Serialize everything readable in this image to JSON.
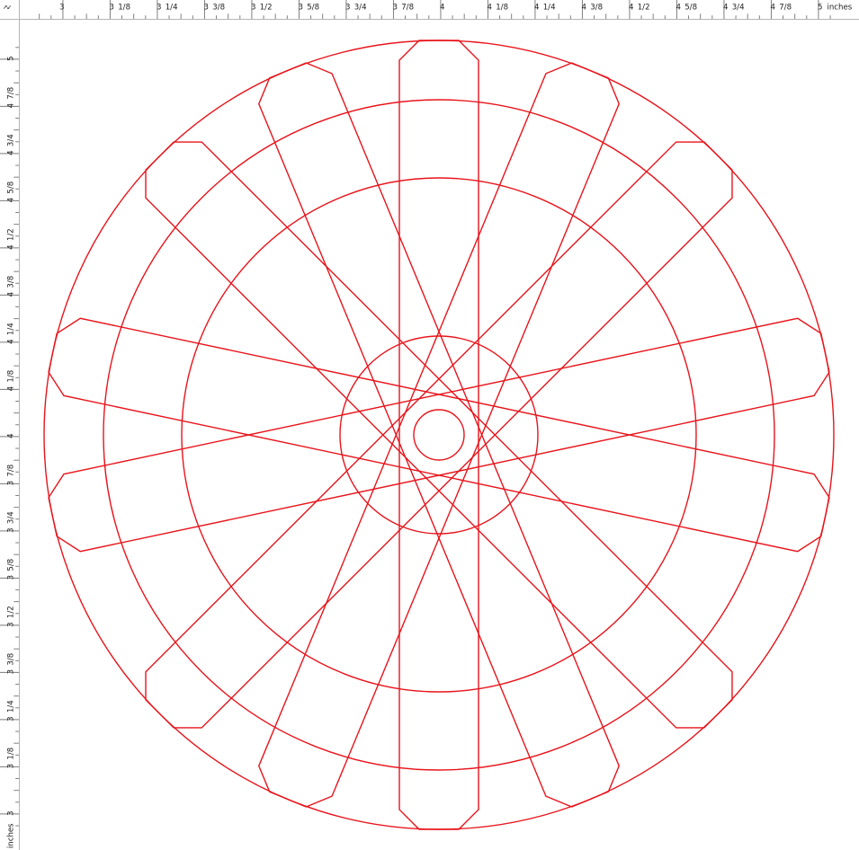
{
  "ruler": {
    "unit_label": "inches",
    "corner_icon": "↗↙",
    "top_labels": [
      "3",
      "3 1/8",
      "3 1/4",
      "3 3/8",
      "3 1/2",
      "3 5/8",
      "3 3/4",
      "3 7/8",
      "4",
      "4 1/8",
      "4 1/4",
      "4 3/8",
      "4 1/2",
      "4 5/8",
      "4 3/4",
      "4 7/8",
      "5"
    ],
    "left_labels": [
      "5",
      "4 7/8",
      "4 3/4",
      "4 5/8",
      "4 1/2",
      "4 3/8",
      "4 1/4",
      "4 1/8",
      "4",
      "3 7/8",
      "3 3/4",
      "3 5/8",
      "3 1/2",
      "3 3/8",
      "3 1/4",
      "3 1/8",
      "3"
    ]
  },
  "drawing": {
    "stroke_color": "#e8141b",
    "shapes": [
      "outer-circle",
      "middle-circle",
      "inner-circle",
      "hub-circle",
      "axle-circle",
      "spoke-bars"
    ]
  }
}
